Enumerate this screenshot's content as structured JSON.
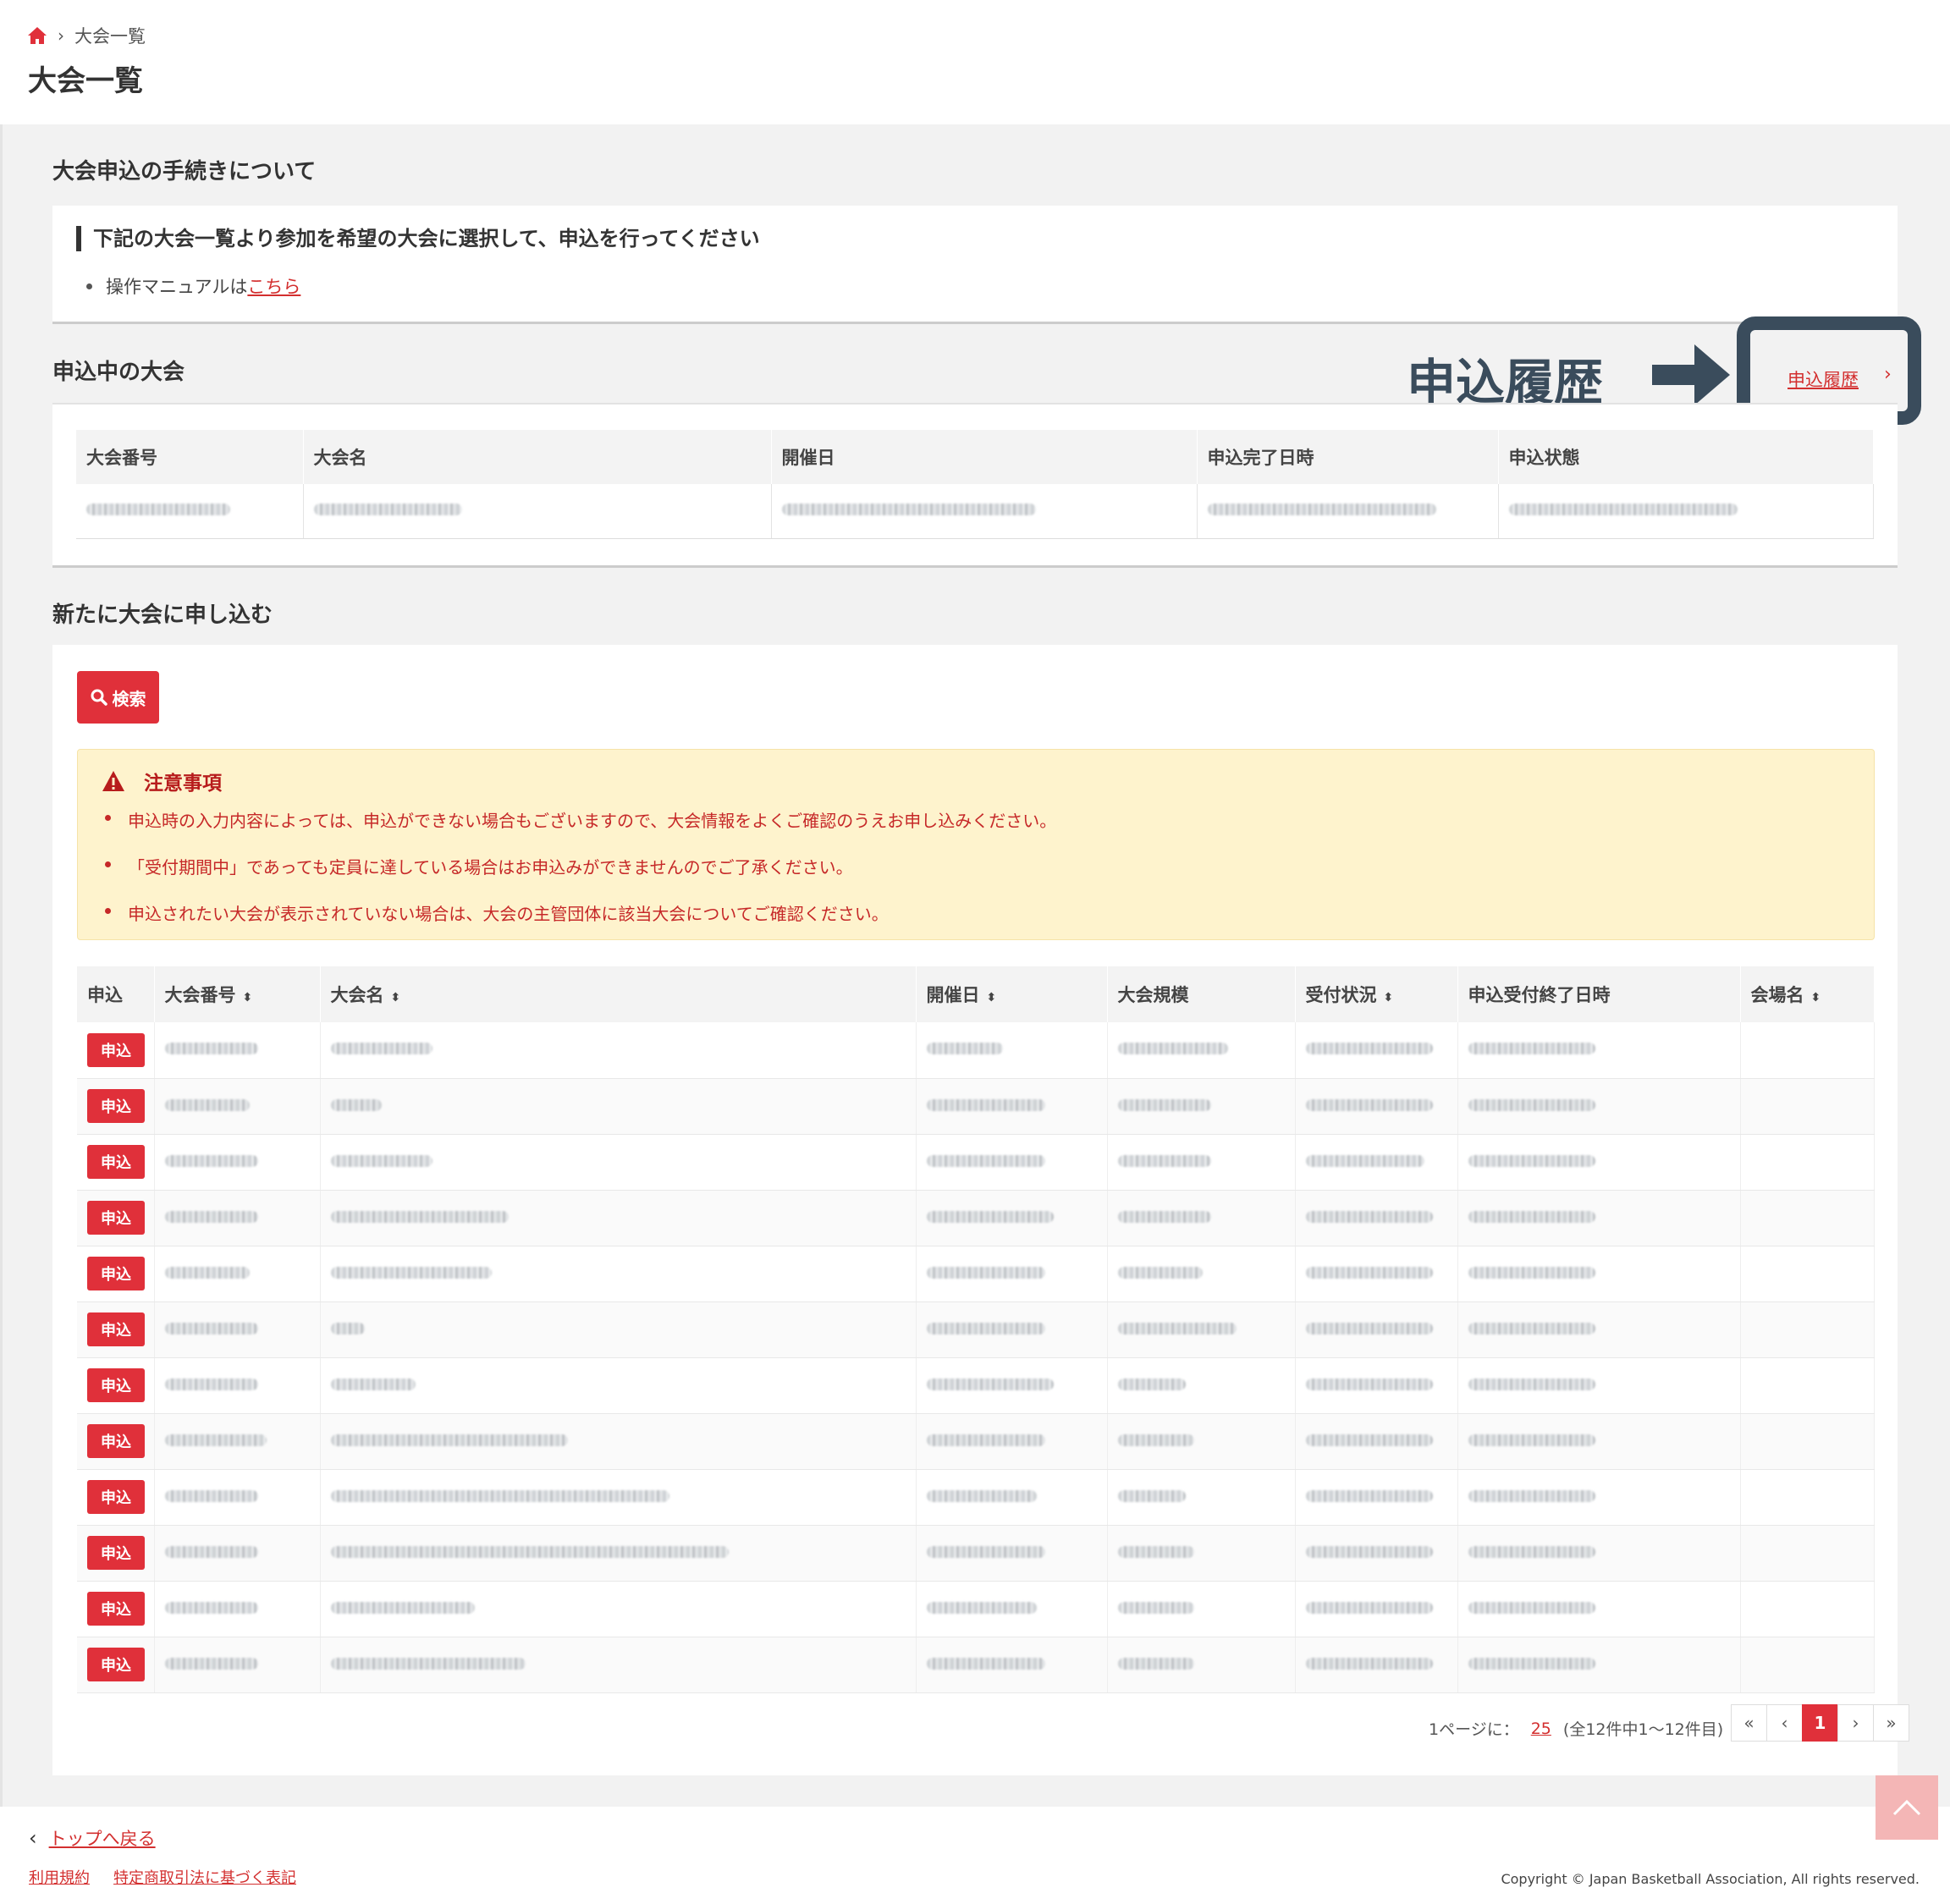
{
  "breadcrumb": {
    "current": "大会一覧"
  },
  "page_title": "大会一覧",
  "section_procedure": {
    "title": "大会申込の手続きについて",
    "heading": "下記の大会一覧より参加を希望の大会に選択して、申込を行ってください",
    "manual_prefix": "操作マニュアルは",
    "manual_link": "こちら"
  },
  "section_applied": {
    "title": "申込中の大会",
    "history_link": "申込履歴",
    "annotation_label": "申込履歴",
    "columns": [
      "大会番号",
      "大会名",
      "開催日",
      "申込完了日時",
      "申込状態"
    ]
  },
  "section_new": {
    "title": "新たに大会に申し込む",
    "search_label": "検索",
    "notice": {
      "title": "注意事項",
      "items": [
        "申込時の入力内容によっては、申込ができない場合もございますので、大会情報をよくご確認のうえお申し込みください。",
        "「受付期間中」であっても定員に達している場合はお申込みができませんのでご了承ください。",
        "申込されたい大会が表示されていない場合は、大会の主管団体に該当大会についてご確認ください。"
      ]
    },
    "columns": [
      "申込",
      "大会番号",
      "大会名",
      "開催日",
      "大会規模",
      "受付状況",
      "申込受付終了日時",
      "会場名"
    ],
    "apply_label": "申込",
    "row_count": 12
  },
  "pagination": {
    "per_page_label": "1ページに：",
    "per_page_value": "25",
    "summary": "(全12件中1～12件目)",
    "first": "«",
    "prev": "‹",
    "current": "1",
    "next": "›",
    "last": "»"
  },
  "footer": {
    "back_link": "トップへ戻る",
    "terms": "利用規約",
    "commerce": "特定商取引法に基づく表記",
    "copyright": "Copyright © Japan Basketball Association, All rights reserved."
  },
  "colors": {
    "accent": "#e0303a",
    "annotation": "#3a4c5c",
    "notice_bg": "#fef3cd"
  },
  "icons": [
    "home-icon",
    "search-icon",
    "warning-icon",
    "arrow-right-icon",
    "chevron-left-icon",
    "chevron-up-icon"
  ]
}
